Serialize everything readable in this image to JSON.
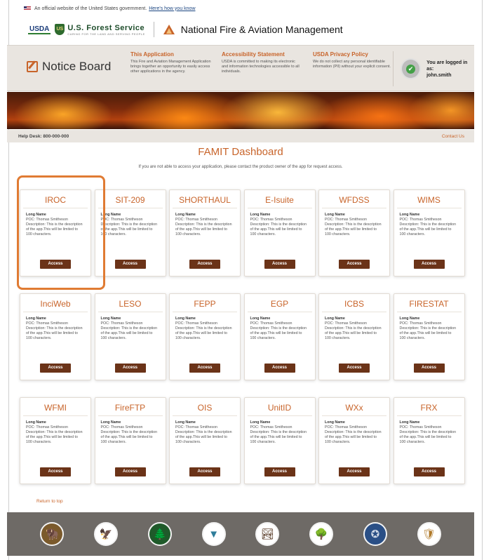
{
  "gov_banner": {
    "text": "An official website of the United States government.",
    "link": "Here's how you know"
  },
  "agency": {
    "usda": "USDA",
    "forest_service": "U.S. Forest Service",
    "forest_service_tagline": "CARING FOR THE LAND AND SERVING PEOPLE",
    "fs_shield_letters": "US",
    "title": "National Fire & Aviation Management"
  },
  "notice": {
    "title": "Notice Board",
    "columns": [
      {
        "heading": "This Application",
        "text": "This Fire and Aviation Management Application brings together an opportunity to easily access other applications in the agency."
      },
      {
        "heading": "Accessibility Statement",
        "text": "USDA is committed to making its electronic and information technologies accessible to all individuals."
      },
      {
        "heading": "USDA Privacy Policy",
        "text": "We do not collect any personal identifiable information (PII) without your explicit consent."
      }
    ],
    "user": {
      "line1": "You are logged in as:",
      "line2": "john.smith"
    }
  },
  "helpbar": {
    "help": "Help Desk: 800-000-000",
    "contact": "Contact Us"
  },
  "dashboard": {
    "title": "FAMIT Dashboard",
    "subtitle": "If you are not able to access your application, please contact the product owner of the app for request access."
  },
  "card_text": {
    "long_name": "Long Name",
    "poc": "POC: Thomas Smitheson",
    "description": "Description: This is the description of the app.This will be limited to 100 characters.",
    "access": "Access"
  },
  "apps": [
    "IROC",
    "SIT-209",
    "SHORTHAUL",
    "E-Isuite",
    "WFDSS",
    "WIMS",
    "InciWeb",
    "LESO",
    "FEPP",
    "EGP",
    "ICBS",
    "FIRESTAT",
    "WFMI",
    "FireFTP",
    "OIS",
    "UnitID",
    "WXx",
    "FRX"
  ],
  "return_to_top": "Return to top",
  "footer_seals": [
    "bison-seal-icon",
    "eagle-seal-icon",
    "forest-service-seal-icon",
    "blm-seal-icon",
    "nps-arrowhead-icon",
    "fws-seal-icon",
    "doi-seal-icon",
    "bia-seal-icon"
  ],
  "colors": {
    "accent": "#c8642a",
    "button": "#6b3318",
    "highlight": "#e07b33",
    "footer": "#6e6a66"
  }
}
